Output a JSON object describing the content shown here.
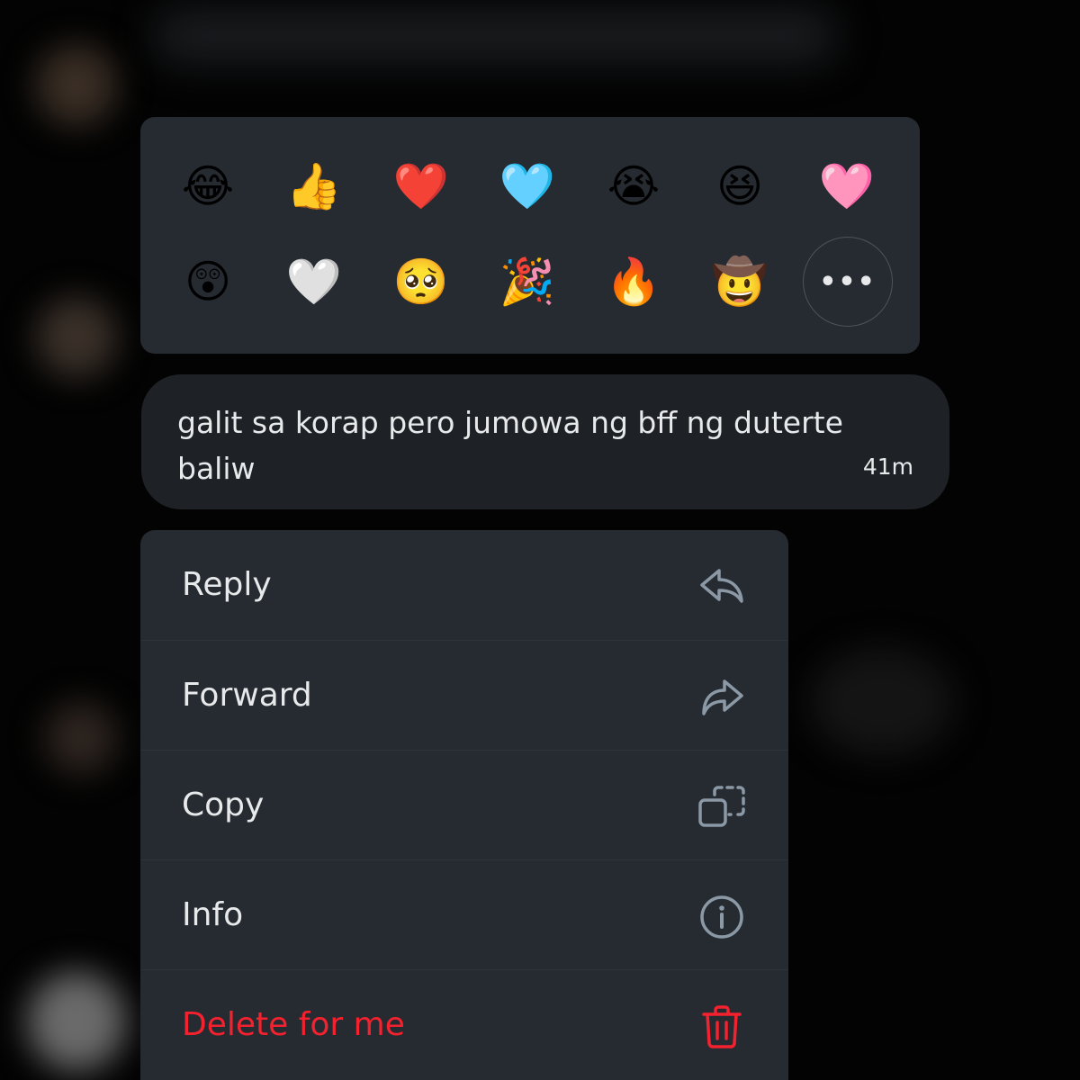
{
  "reactions": {
    "row1": [
      "😂",
      "👍",
      "❤️",
      "🩵",
      "😭",
      "😆",
      "🩷"
    ],
    "row2": [
      "😲",
      "🤍",
      "🥺",
      "🎉",
      "🔥",
      "🤠"
    ],
    "more_label": "•••"
  },
  "message": {
    "text": "galit sa korap pero jumowa ng bff ng duterte baliw",
    "time": "41m"
  },
  "menu": {
    "items": [
      {
        "label": "Reply",
        "icon": "reply-icon"
      },
      {
        "label": "Forward",
        "icon": "forward-icon"
      },
      {
        "label": "Copy",
        "icon": "copy-icon"
      },
      {
        "label": "Info",
        "icon": "info-icon"
      },
      {
        "label": "Delete for me",
        "icon": "trash-icon"
      }
    ]
  },
  "colors": {
    "panel_bg": "#262b31",
    "bubble_bg": "#1e2125",
    "text": "#e7e9ea",
    "icon": "#8b98a5",
    "danger": "#f4212e"
  }
}
